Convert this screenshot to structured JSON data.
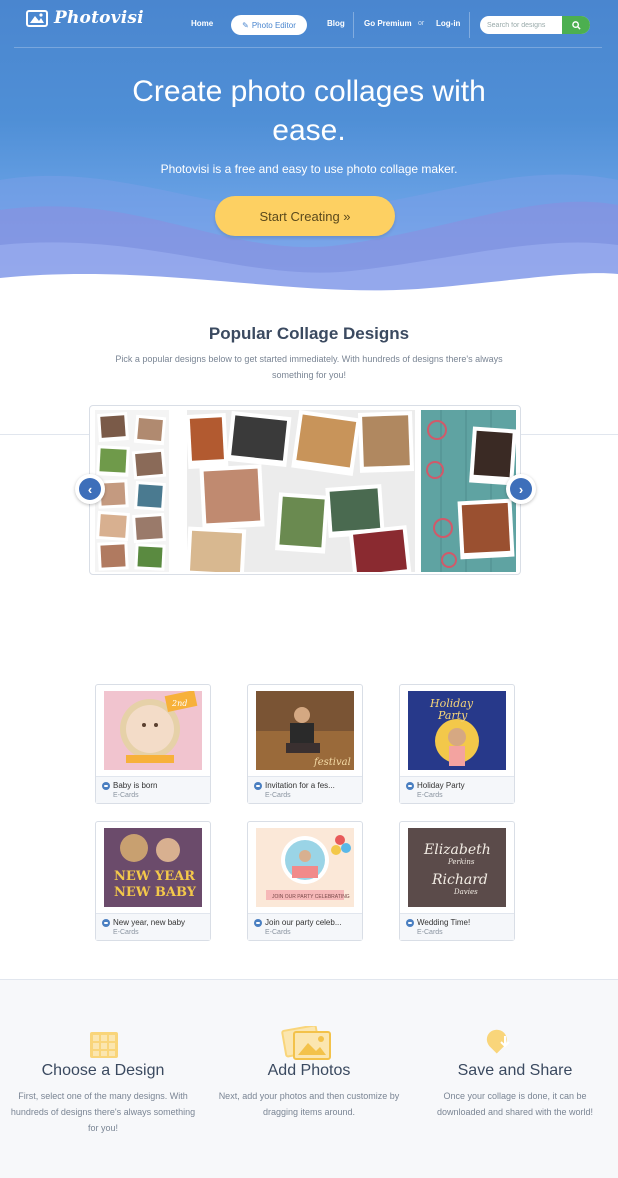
{
  "brand": {
    "name": "Photovisi"
  },
  "nav": {
    "home": "Home",
    "photo_editor": "Photo Editor",
    "blog": "Blog",
    "go_premium": "Go Premium",
    "or": "or",
    "login": "Log-in",
    "search_placeholder": "Search for designs"
  },
  "hero": {
    "title_line1": "Create photo collages with",
    "title_line2": "ease.",
    "subtitle": "Photovisi is a free and easy to use photo collage maker.",
    "cta": "Start Creating »"
  },
  "popular": {
    "title": "Popular Collage Designs",
    "description": "Pick a popular designs below to get started immediately. With hundreds of designs there's always something for you!"
  },
  "cards": [
    {
      "title": "Baby is born",
      "category": "E-Cards",
      "thumb_text": "2nd"
    },
    {
      "title": "Invitation for a fes...",
      "category": "E-Cards",
      "thumb_text": "festival"
    },
    {
      "title": "Holiday Party",
      "category": "E-Cards",
      "thumb_text": "Holiday Party"
    },
    {
      "title": "New year, new baby",
      "category": "E-Cards",
      "thumb_text": "NEW YEAR NEW BABY"
    },
    {
      "title": "Join our party celeb...",
      "category": "E-Cards",
      "thumb_text": "JOIN OUR PARTY CELEBRATING"
    },
    {
      "title": "Wedding Time!",
      "category": "E-Cards",
      "thumb_text": "Elizabeth Perkins Richard Davies"
    }
  ],
  "features": [
    {
      "title": "Choose a Design",
      "description": "First, select one of the many designs. With hundreds of designs there's always something for you!",
      "icon": "grid-icon"
    },
    {
      "title": "Add Photos",
      "description": "Next, add your photos and then customize by dragging items around.",
      "icon": "photos-icon"
    },
    {
      "title": "Save and Share",
      "description": "Once your collage is done, it can be downloaded and shared with the world!",
      "icon": "heart-download-icon"
    }
  ],
  "colors": {
    "hero_blue": "#4a86cf",
    "cta_yellow": "#fdd062",
    "search_green": "#4caf50",
    "arrow_blue": "#3e6fba",
    "feature_icon_yellow": "#f9d57a"
  }
}
